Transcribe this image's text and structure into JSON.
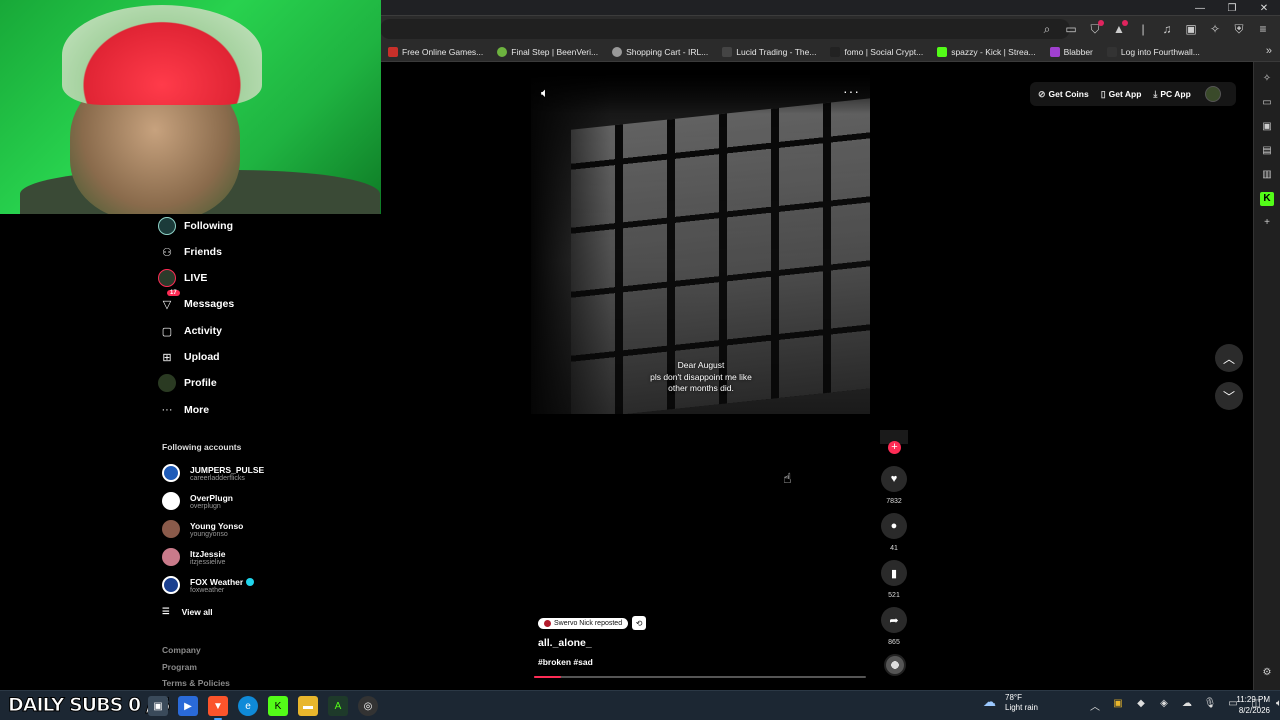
{
  "bookmarks": [
    {
      "label": "Free Online Games...",
      "color": "#c8302a"
    },
    {
      "label": "Final Step | BeenVeri...",
      "color": "#6db33f"
    },
    {
      "label": "Shopping Cart - IRL...",
      "color": "#999999"
    },
    {
      "label": "Lucid Trading - The...",
      "color": "#444444"
    },
    {
      "label": "fomo | Social Crypt...",
      "color": "#222222"
    },
    {
      "label": "spazzy - Kick | Strea...",
      "color": "#53fc18"
    },
    {
      "label": "Blabber",
      "color": "#a040d0"
    },
    {
      "label": "Log into Fourthwall...",
      "color": "#333333"
    }
  ],
  "bookmarks_more": "»",
  "window_controls": {
    "minimize": "—",
    "restore": "❐",
    "close": "✕"
  },
  "sidebar": {
    "items": [
      {
        "label": "Following",
        "icon": "following-icon"
      },
      {
        "label": "Friends",
        "icon": "friends-icon"
      },
      {
        "label": "LIVE",
        "icon": "live-icon"
      },
      {
        "label": "Messages",
        "icon": "messages-icon",
        "badge": "17"
      },
      {
        "label": "Activity",
        "icon": "activity-icon"
      },
      {
        "label": "Upload",
        "icon": "upload-icon"
      },
      {
        "label": "Profile",
        "icon": "profile-icon"
      },
      {
        "label": "More",
        "icon": "more-icon"
      }
    ],
    "following_heading": "Following accounts",
    "accounts": [
      {
        "name": "JUMPERS_PULSE",
        "handle": "careerladderflicks",
        "color": "#1e5bb8",
        "verified": false
      },
      {
        "name": "OverPlugn",
        "handle": "overplugn",
        "color": "#ffffff",
        "verified": false
      },
      {
        "name": "Young Yonso",
        "handle": "youngyonso",
        "color": "#8a5a4a",
        "verified": false
      },
      {
        "name": "ItzJessie",
        "handle": "itzjessielive",
        "color": "#c97a8a",
        "verified": false
      },
      {
        "name": "FOX Weather",
        "handle": "foxweather",
        "color": "#1a3f8f",
        "verified": true
      }
    ],
    "view_all": "View all",
    "footer": [
      "Company",
      "Program",
      "Terms & Policies"
    ]
  },
  "top_buttons": {
    "get_coins": "Get Coins",
    "get_app": "Get App",
    "pc_app": "PC App"
  },
  "video": {
    "caption_lines": [
      "Dear August",
      "pls don't disappoint me like",
      "other months did."
    ],
    "repost_label": "Swervo Nick reposted",
    "author": "all._alone_",
    "tags": "#broken #sad",
    "progress": 0.08
  },
  "actions": {
    "likes": "7832",
    "comments": "41",
    "saves": "521",
    "shares": "865"
  },
  "taskbar": {
    "subs_label": "DAILY SUBS 0 / 5",
    "weather_temp": "78°F",
    "weather_desc": "Light rain",
    "weather_badge": "1",
    "time": "11:29 PM",
    "date": "8/2/2026"
  },
  "colors": {
    "accent": "#fe2c55",
    "kick_green": "#53fc18",
    "taskbar": "#1c2733"
  }
}
